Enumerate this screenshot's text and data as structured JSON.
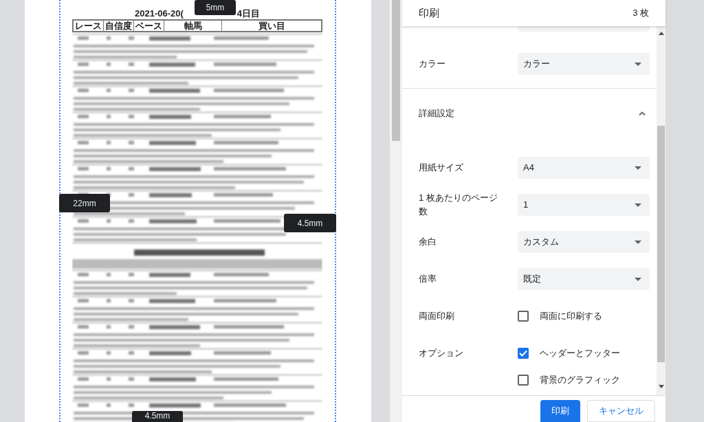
{
  "preview": {
    "title_left": "2021-06-20(",
    "title_right": "4日目",
    "table_columns": [
      "レース",
      "自信度",
      "ベース",
      "軸馬",
      "買い目"
    ],
    "margin_labels": [
      {
        "text": "5mm",
        "kind": "top"
      },
      {
        "text": "22mm",
        "kind": "left"
      },
      {
        "text": "4.5mm",
        "kind": "right"
      },
      {
        "text": "4.5mm",
        "kind": "bottom"
      }
    ]
  },
  "panel": {
    "title": "印刷",
    "sheets": "3 枚",
    "settings": [
      {
        "kind": "select",
        "label": "カラー",
        "value": "カラー"
      },
      {
        "kind": "section",
        "label": "詳細設定",
        "expanded": true
      },
      {
        "kind": "select",
        "label": "用紙サイズ",
        "value": "A4"
      },
      {
        "kind": "select",
        "label": "1 枚あたりのページ数",
        "value": "1"
      },
      {
        "kind": "select",
        "label": "余白",
        "value": "カスタム"
      },
      {
        "kind": "select",
        "label": "倍率",
        "value": "既定"
      },
      {
        "kind": "checkbox",
        "label": "両面印刷",
        "option": "両面に印刷する",
        "checked": false
      },
      {
        "kind": "checkbox",
        "label": "オプション",
        "option": "ヘッダーとフッター",
        "checked": true
      },
      {
        "kind": "checkbox",
        "option": "背景のグラフィック",
        "checked": false
      }
    ],
    "buttons": [
      {
        "label": "印刷",
        "kind": "primary"
      },
      {
        "label": "キャンセル",
        "kind": "secondary"
      }
    ]
  }
}
